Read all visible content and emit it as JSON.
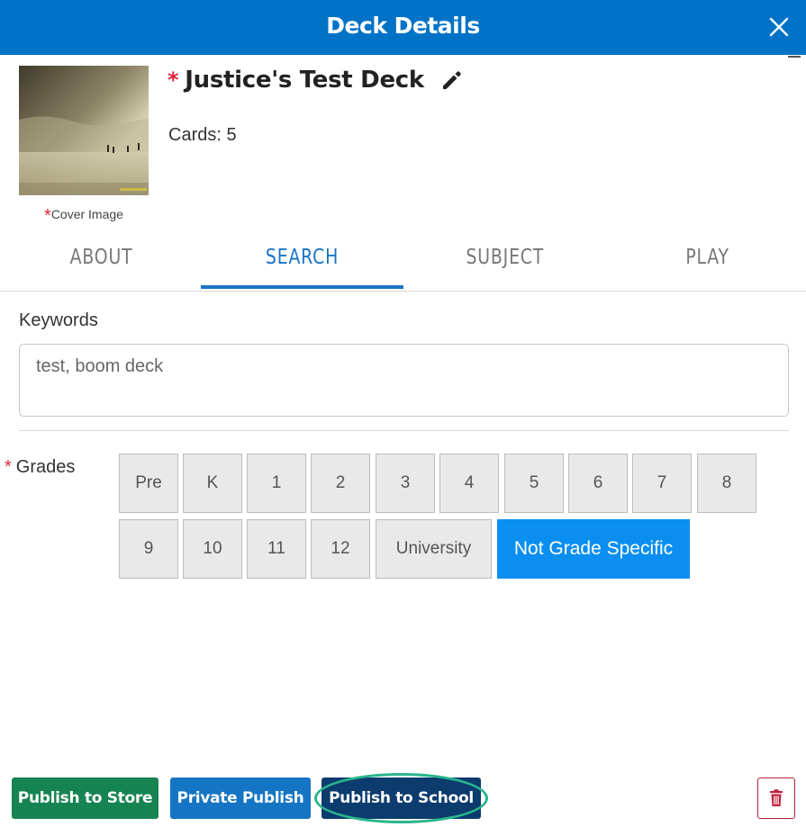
{
  "header": {
    "title": "Deck Details",
    "close_icon": "close-icon",
    "bg_color": "#0073c6"
  },
  "deck": {
    "required_mark": "*",
    "title": "Justice's Test Deck",
    "edit_icon": "pencil-icon",
    "cards_label": "Cards: 5",
    "cover_required_mark": "*",
    "cover_caption": "Cover Image"
  },
  "tabs": [
    {
      "label": "ABOUT",
      "active": false
    },
    {
      "label": "SEARCH",
      "active": true
    },
    {
      "label": "SUBJECT",
      "active": false
    },
    {
      "label": "PLAY",
      "active": false
    }
  ],
  "keywords": {
    "label": "Keywords",
    "value": "test, boom deck"
  },
  "grades": {
    "required_mark": "*",
    "label": "Grades",
    "row1": [
      "Pre",
      "K",
      "1",
      "2",
      "3",
      "4",
      "5",
      "6",
      "7",
      "8"
    ],
    "row2": [
      "9",
      "10",
      "11",
      "12",
      "University",
      "Not Grade Specific"
    ],
    "selected": "Not Grade Specific"
  },
  "footer": {
    "publish_store": "Publish to Store",
    "private_publish": "Private Publish",
    "publish_school": "Publish to School",
    "delete_icon": "trash-icon"
  },
  "colors": {
    "accent": "#1a73c5",
    "selected_grade": "#0a8ff0",
    "store_button": "#168452",
    "private_button": "#1575c4",
    "school_button": "#0c3b6e",
    "required": "#e0243a",
    "highlight_ring": "#2ab58c"
  }
}
